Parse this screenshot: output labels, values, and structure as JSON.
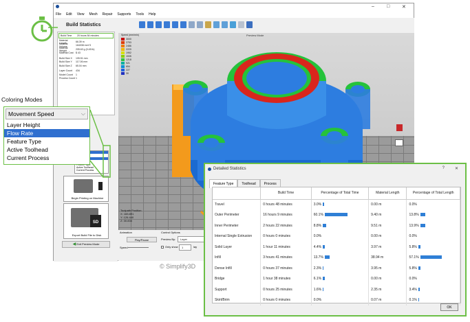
{
  "app": {
    "menus": [
      "File",
      "Edit",
      "View",
      "Mesh",
      "Repair",
      "Supports",
      "Tools",
      "Help"
    ],
    "controls": [
      "–",
      "□",
      "✕"
    ]
  },
  "build_stats": {
    "title": "Build Statistics",
    "rows": [
      {
        "k": "Build Time",
        "v": "20 hours 54 minutes"
      },
      {
        "k": "Material Length",
        "v": "66.39 m"
      },
      {
        "k": "Material Volume",
        "v": "164038 mm^3"
      },
      {
        "k": "Material Weight",
        "v": "205.63 g (0.45 lb)"
      },
      {
        "k": "Material Cost",
        "v": "$ 43"
      },
      {
        "k": "Build Size X",
        "v": "105.51 mm"
      },
      {
        "k": "Build Size Y",
        "v": "117.06 mm"
      },
      {
        "k": "Build Size Z",
        "v": "65.04 mm"
      },
      {
        "k": "Layer Count",
        "v": "434"
      },
      {
        "k": "Model Count",
        "v": "1"
      },
      {
        "k": "Process Count",
        "v": "1"
      }
    ]
  },
  "legend": {
    "title": "Speed (mm/min)",
    "items": [
      "3000",
      "2753",
      "2486",
      "2220",
      "1952",
      "1535",
      "1218",
      "921",
      "654",
      "227",
      "30"
    ]
  },
  "preview_mode": "Preview Mode",
  "coloring": {
    "title": "Coloring Modes",
    "selected": "Movement Speed",
    "options": [
      "Layer Height",
      "Flow Rate",
      "Feature Type",
      "Active Toolhead",
      "Current Process"
    ],
    "mini_options": [
      "Speed",
      "Speed",
      "Feature Type",
      "Active Toolhead",
      "Current Process"
    ]
  },
  "toolpath_label": "Toolpath Position",
  "toolpath": [
    "X: 165.891",
    "Y: 126.440",
    "Z: 30.833"
  ],
  "buttons": {
    "begin": "Begin Printing on Machine",
    "export": "Export Build File to Disk",
    "exit": "Exit Preview Mode",
    "play": "Play/Pause",
    "sd": "SD"
  },
  "animation": {
    "label": "Animation",
    "speed": "Speed",
    "control": "Control Options",
    "preview_by": "Preview By:",
    "preview_val": "Layer",
    "only_show": "Only show",
    "only_val": "1",
    "layers": "lay"
  },
  "copyright": "© Simplify3D",
  "dialog": {
    "title": "Detailed Statistics",
    "help": "?",
    "close": "✕",
    "tabs": [
      "Feature Type",
      "Toolhead",
      "Process"
    ],
    "headers": [
      "",
      "Build Time",
      "Percentage of Total Time",
      "Material Length",
      "Percentage of Total Length"
    ],
    "rows": [
      {
        "name": "Travel",
        "time": "0 hours 48 minutes",
        "pt": "3.0%",
        "ptv": 3.0,
        "ml": "0.00 m",
        "pl": "0.0%",
        "plv": 0.0
      },
      {
        "name": "Outer Perimeter",
        "time": "16 hours 9 minutes",
        "pt": "60.1%",
        "ptv": 60.1,
        "ml": "9.40 m",
        "pl": "13.8%",
        "plv": 13.8
      },
      {
        "name": "Inner Perimeter",
        "time": "2 hours 22 minutes",
        "pt": "8.8%",
        "ptv": 8.8,
        "ml": "9.51 m",
        "pl": "13.9%",
        "plv": 13.9
      },
      {
        "name": "Internal Single Extrusion",
        "time": "0 hours 0 minutes",
        "pt": "0.0%",
        "ptv": 0.0,
        "ml": "0.00 m",
        "pl": "0.0%",
        "plv": 0.0
      },
      {
        "name": "Solid Layer",
        "time": "1 hour 11 minutes",
        "pt": "4.4%",
        "ptv": 4.4,
        "ml": "3.97 m",
        "pl": "5.8%",
        "plv": 5.8
      },
      {
        "name": "Infill",
        "time": "3 hours 41 minutes",
        "pt": "13.7%",
        "ptv": 13.7,
        "ml": "38.94 m",
        "pl": "57.1%",
        "plv": 57.1
      },
      {
        "name": "Dense Infill",
        "time": "0 hours 37 minutes",
        "pt": "2.3%",
        "ptv": 2.3,
        "ml": "3.95 m",
        "pl": "5.8%",
        "plv": 5.8
      },
      {
        "name": "Bridge",
        "time": "1 hour 38 minutes",
        "pt": "6.1%",
        "ptv": 6.1,
        "ml": "0.00 m",
        "pl": "0.0%",
        "plv": 0.0
      },
      {
        "name": "Support",
        "time": "0 hours 25 minutes",
        "pt": "1.6%",
        "ptv": 1.6,
        "ml": "2.35 m",
        "pl": "3.4%",
        "plv": 3.4
      },
      {
        "name": "Skirt/Brim",
        "time": "0 hours 0 minutes",
        "pt": "0.0%",
        "ptv": 0.0,
        "ml": "0.07 m",
        "pl": "0.1%",
        "plv": 0.1
      }
    ],
    "ok": "OK"
  },
  "colors": {
    "accent": "#6bbf45",
    "bar": "#2f7fd6",
    "model_blue": "#2d7de0",
    "model_red": "#d9261c",
    "model_green": "#25c23b",
    "model_orange": "#f39a1c"
  }
}
